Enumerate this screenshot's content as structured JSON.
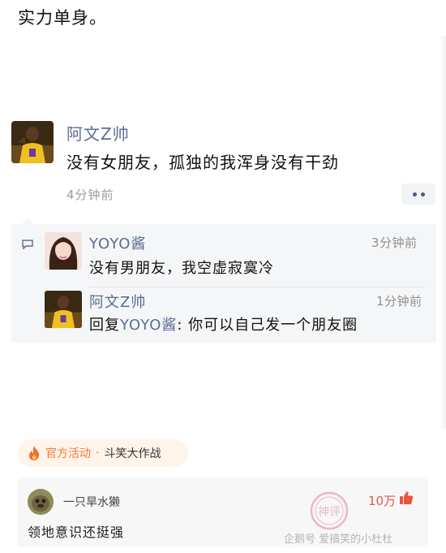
{
  "headline": "实力单身。",
  "post": {
    "author": "阿文Z帅",
    "text": "没有女朋友，孤独的我浑身没有干劲",
    "time": "4分钟前",
    "more_icon": "more-dots-icon"
  },
  "comments": [
    {
      "author": "YOYO酱",
      "time": "3分钟前",
      "text": "没有男朋友，我空虚寂寞冷"
    },
    {
      "author": "阿文Z帅",
      "time": "1分钟前",
      "reply_prefix": "回复",
      "reply_target": "YOYO酱",
      "reply_text": ": 你可以自己发一个朋友圈"
    }
  ],
  "event": {
    "label": "官方活动",
    "separator": "·",
    "name": "斗笑大作战"
  },
  "hot_comment": {
    "user": "一只旱水獭",
    "likes": "10万",
    "text": "领地意识还挺强"
  },
  "watermark": "企鹅号 爱搞笑的小杜杜",
  "stamp_text": "神评",
  "colors": {
    "name_blue": "#5b6d93",
    "accent_orange": "#f07a3a",
    "like_red": "#e8543f"
  }
}
